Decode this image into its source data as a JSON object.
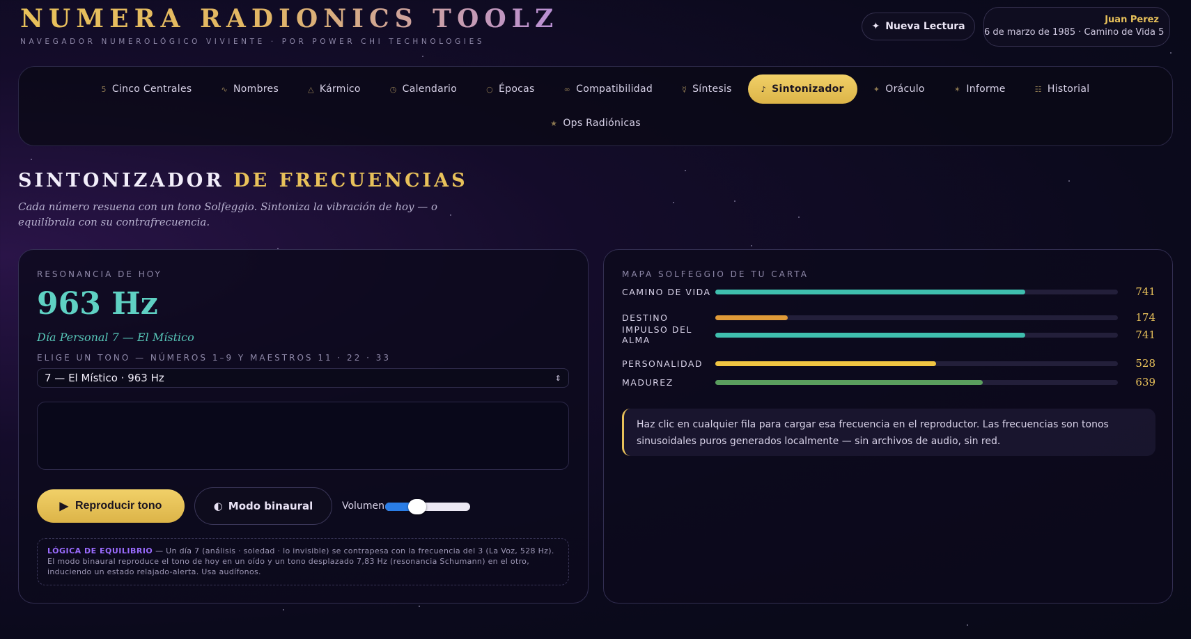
{
  "brand": {
    "title": "NUMERA RADIONICS TOOLZ",
    "subtitle": "NAVEGADOR NUMEROLÓGICO VIVIENTE · POR POWER CHI TECHNOLOGIES"
  },
  "header": {
    "new_reading_label": "Nueva Lectura",
    "user_name": "Juan Perez",
    "user_meta": "6 de marzo de 1985 · Camino de Vida 5"
  },
  "nav": {
    "row1": [
      {
        "icon": "5",
        "label": "Cinco Centrales"
      },
      {
        "icon": "∿",
        "label": "Nombres"
      },
      {
        "icon": "△",
        "label": "Kármico"
      },
      {
        "icon": "◷",
        "label": "Calendario"
      },
      {
        "icon": "○",
        "label": "Épocas"
      },
      {
        "icon": "∞",
        "label": "Compatibilidad"
      },
      {
        "icon": "☿",
        "label": "Síntesis"
      },
      {
        "icon": "♪",
        "label": "Sintonizador"
      },
      {
        "icon": "✦",
        "label": "Oráculo"
      },
      {
        "icon": "✶",
        "label": "Informe"
      },
      {
        "icon": "☷",
        "label": "Historial"
      }
    ],
    "row2": [
      {
        "icon": "★",
        "label": "Ops Radiónicas"
      }
    ],
    "active": "Sintonizador"
  },
  "section": {
    "title_a": "SINTONIZADOR",
    "title_b": "DE FRECUENCIAS",
    "description": "Cada número resuena con un tono Solfeggio. Sintoniza la vibración de hoy — o equilíbrala con su contrafrecuencia."
  },
  "tuner": {
    "kicker": "RESONANCIA DE HOY",
    "frequency": "963 Hz",
    "day_label": "Día Personal 7 — El Místico",
    "choose_label": "ELIGE UN TONO — NÚMEROS 1–9 Y MAESTROS 11 · 22 · 33",
    "selected_tone": "7 — El Místico · 963 Hz",
    "play_label": "Reproducir tono",
    "binaural_label": "Modo binaural",
    "volume_label": "Volumen",
    "volume": 0.38,
    "logic_title": "LÓGICA DE EQUILIBRIO",
    "logic_text": " — Un día 7 (análisis · soledad · lo invisible) se contrapesa con la frecuencia del 3 (La Voz, 528 Hz). El modo binaural reproduce el tono de hoy en un oído y un tono desplazado 7,83 Hz (resonancia Schumann) en el otro, induciendo un estado relajado-alerta. Usa audífonos."
  },
  "solfeggio": {
    "kicker": "MAPA SOLFEGGIO DE TU CARTA",
    "max": 963,
    "rows": [
      {
        "label": "CAMINO DE VIDA",
        "value": 741,
        "color": "#3fbfae"
      },
      {
        "label": "DESTINO",
        "value": 174,
        "color": "#e09a38"
      },
      {
        "label": "IMPULSO DEL ALMA",
        "value": 741,
        "color": "#3fbfae"
      },
      {
        "label": "PERSONALIDAD",
        "value": 528,
        "color": "#f0c542"
      },
      {
        "label": "MADUREZ",
        "value": 639,
        "color": "#5a9e5e"
      }
    ],
    "hint": "Haz clic en cualquier fila para cargar esa frecuencia en el reproductor. Las frecuencias son tonos sinusoidales puros generados localmente — sin archivos de audio, sin red."
  }
}
